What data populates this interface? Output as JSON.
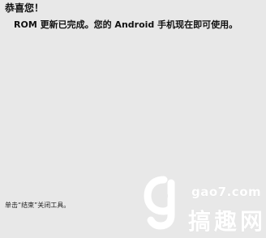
{
  "dialog": {
    "title": "恭喜您！",
    "message": "ROM 更新已完成。您的 Android 手机现在即可使用。",
    "footer_hint": "单击“结束”关闭工具。"
  },
  "watermark": {
    "url": "gao7.com",
    "name": "搞趣网"
  }
}
